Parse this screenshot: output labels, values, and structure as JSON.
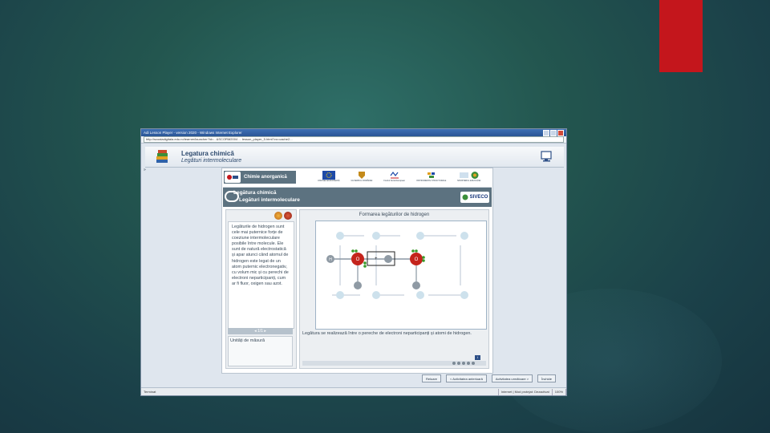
{
  "colors": {
    "accent_bar": "#c4161c",
    "panel_header": "#5c7280"
  },
  "browser": {
    "title": "Adi Lesson Player - version 2020 - Windows Internet Explorer",
    "url": "http://scoaladigitala.edu.ro/learner/launcher?id=...&SCORM2004 ... lesson_player_5.html?vo=cache2...",
    "status_left": "Terminat",
    "status_zone": "Internet | Mod protejat: Dezactivat",
    "zoom": "100%"
  },
  "app": {
    "title": "Legatura chimică",
    "subtitle": "Legături intermoleculare",
    "expand_marker": "»"
  },
  "lesson": {
    "course": "Chimie anorganică",
    "logo_labels": [
      "UNIUNEA EUROPEANĂ",
      "GUVERNUL ROMÂNIEI",
      "Fondul Social European",
      "INSTRUMENTE STRUCTURALE",
      "MINISTERUL EDUCAȚIEI"
    ],
    "section_title": "Legătura chimică",
    "section_subtitle": "Legături intermoleculare",
    "partner": "SIVECO"
  },
  "text_panel": {
    "body": "Legăturile de hidrogen sunt cele mai puternice forțe de coeziune intermoleculare posibile între molecule. Ele sunt de natură electrostatică și apar atunci când atomul de hidrogen este legat de un atom puternic electronegativ, cu volum mic și cu perechi de electroni neparticipanți, cum ar fi fluor, oxigen sau azot.",
    "pager": "1/1",
    "unit_label": "Unități de măsură"
  },
  "simulation": {
    "title": "Formarea legăturilor de hidrogen",
    "caption": "Legătura se realizează între o pereche de electroni neparticipanți și atomi de hidrogen.",
    "atom_labels": {
      "oxygen": "O",
      "hydrogen": "H",
      "plus": "+"
    },
    "corner_button": "i"
  },
  "nav": {
    "buttons": [
      "Reluare",
      "< Activitatea anterioară",
      "Activitatea următoare >",
      "Închide"
    ]
  }
}
